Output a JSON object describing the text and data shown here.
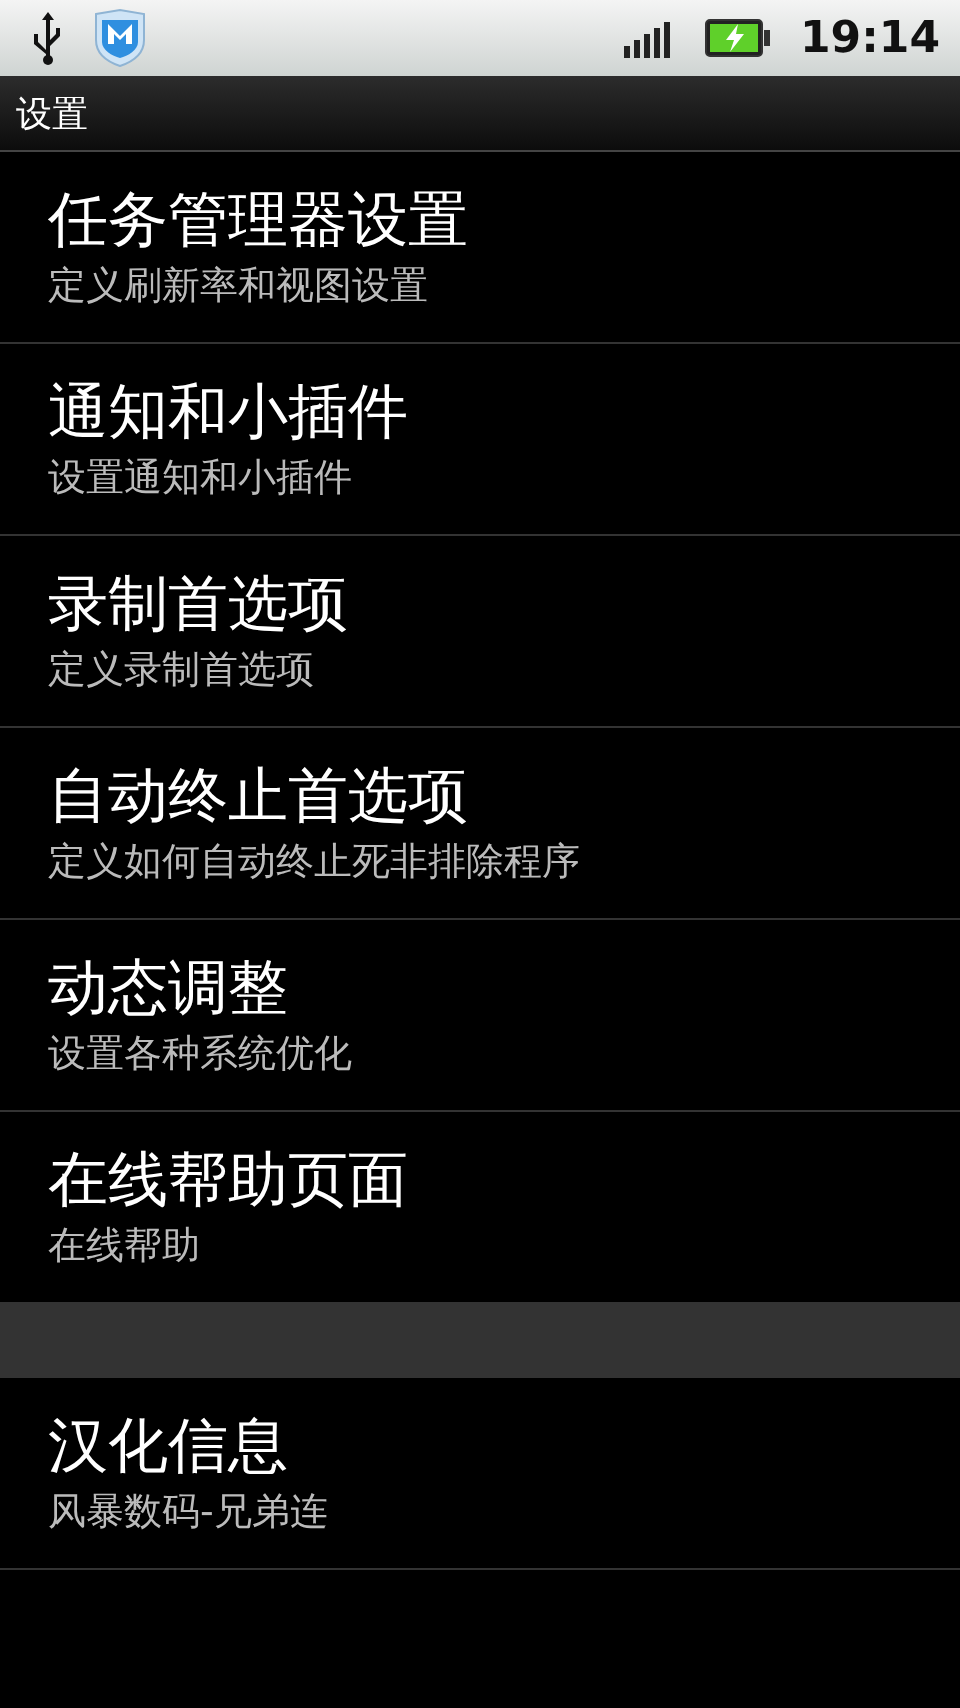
{
  "status_bar": {
    "time": "19:14",
    "battery_charging": true
  },
  "title_bar": {
    "title": "设置"
  },
  "sections": [
    {
      "items": [
        {
          "title": "任务管理器设置",
          "summary": "定义刷新率和视图设置"
        },
        {
          "title": "通知和小插件",
          "summary": "设置通知和小插件"
        },
        {
          "title": "录制首选项",
          "summary": "定义录制首选项"
        },
        {
          "title": "自动终止首选项",
          "summary": "定义如何自动终止死非排除程序"
        },
        {
          "title": "动态调整",
          "summary": "设置各种系统优化"
        },
        {
          "title": "在线帮助页面",
          "summary": "在线帮助"
        }
      ]
    },
    {
      "items": [
        {
          "title": "汉化信息",
          "summary": "风暴数码-兄弟连"
        }
      ]
    }
  ]
}
